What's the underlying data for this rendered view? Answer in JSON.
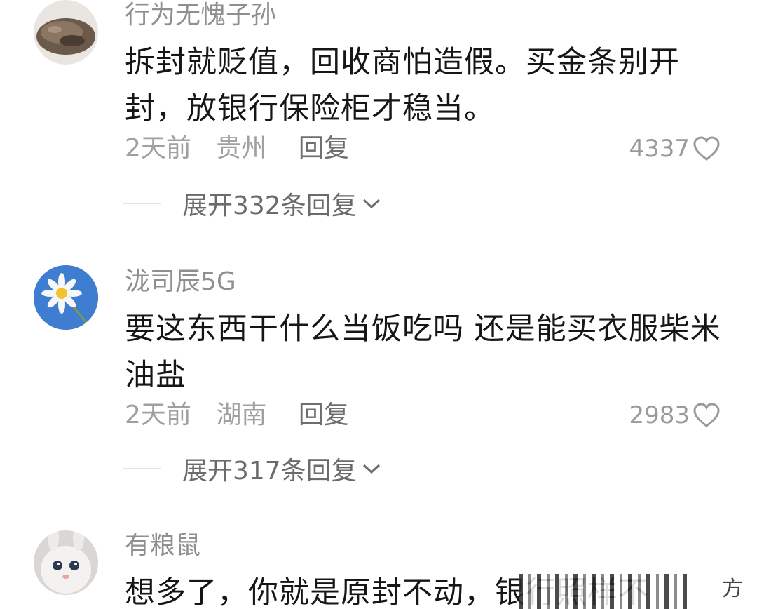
{
  "comments": [
    {
      "username": "行为无愧子孙",
      "text": "拆封就贬值，回收商怕造假。买金条别开封，放银行保险柜才稳当。",
      "time": "2天前",
      "location": "贵州",
      "reply_label": "回复",
      "likes": "4337",
      "expand_label": "展开332条回复",
      "avatar_icon": "rock-avatar"
    },
    {
      "username": "泷司辰5G",
      "text": "要这东西干什么当饭吃吗 还是能买衣服柴米油盐",
      "time": "2天前",
      "location": "湖南",
      "reply_label": "回复",
      "likes": "2983",
      "expand_label": "展开317条回复",
      "avatar_icon": "daisy-avatar"
    },
    {
      "username": "有粮鼠",
      "text": "想多了，你就是原封不动，银行照样不",
      "avatar_icon": "bunny-avatar"
    }
  ],
  "watermark_char": "方",
  "colors": {
    "username": "#8f8f8f",
    "text": "#161616",
    "meta": "#a0a0a0",
    "reply": "#6e6e6e",
    "expand": "#6b6b6b"
  }
}
